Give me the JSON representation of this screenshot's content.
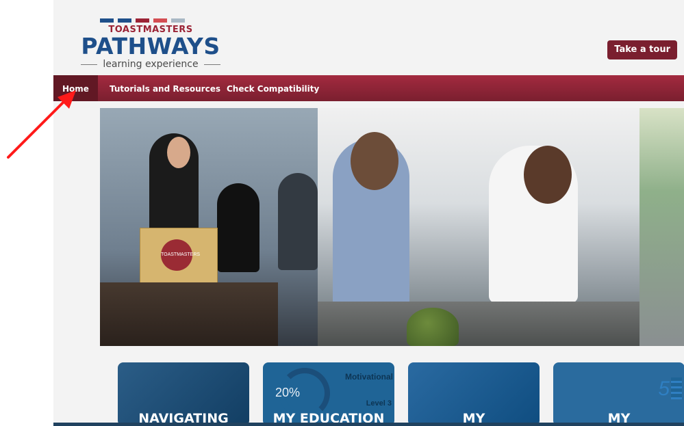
{
  "header": {
    "logo_top": "TOASTMASTERS",
    "logo_main": "PATHWAYS",
    "logo_sub": "learning experience",
    "tour_button": "Take a tour"
  },
  "navigation": {
    "items": [
      {
        "label": "Home"
      },
      {
        "label": "Tutorials and Resources"
      },
      {
        "label": "Check Compatibility"
      }
    ]
  },
  "hero": {
    "podium_logo_text": "TOASTMASTERS"
  },
  "cards": [
    {
      "label": "NAVIGATING"
    },
    {
      "label": "MY EDUCATION",
      "percent": "20%",
      "top_text": "Motivational",
      "level_text": "Level 3"
    },
    {
      "label": "MY"
    },
    {
      "label": "MY",
      "number": "5"
    }
  ],
  "annotation": {
    "arrow_color": "#ff1a1a"
  }
}
